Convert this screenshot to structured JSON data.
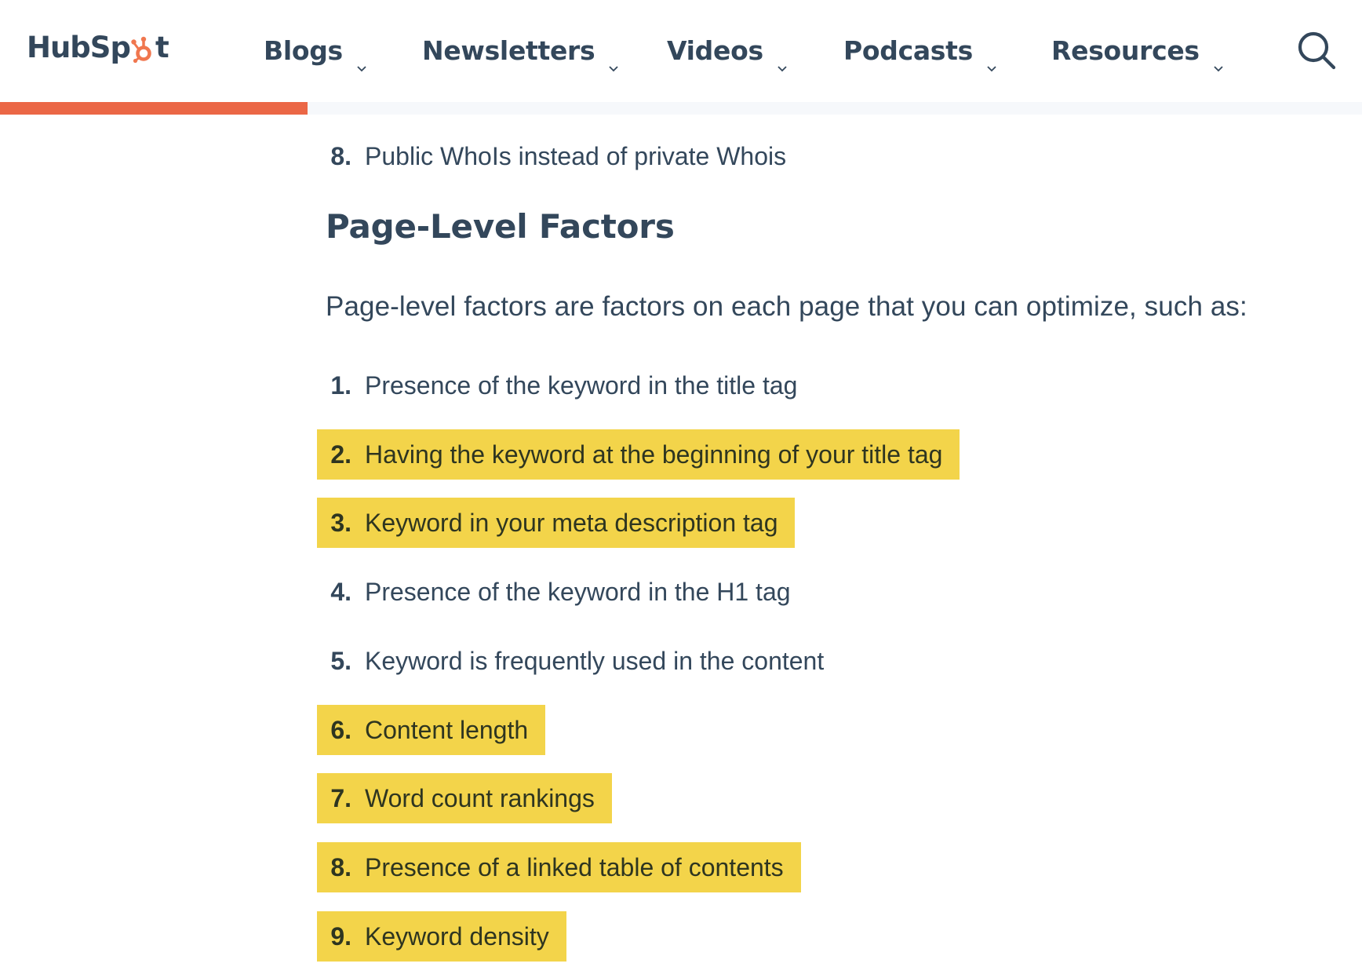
{
  "header": {
    "logo_text_1": "HubSp",
    "logo_text_2": "t",
    "logo_alt": "HubSpot",
    "nav": [
      {
        "label": "Blogs",
        "icon": "chevron-down-icon"
      },
      {
        "label": "Newsletters",
        "icon": "chevron-down-icon"
      },
      {
        "label": "Videos",
        "icon": "chevron-down-icon"
      },
      {
        "label": "Podcasts",
        "icon": "chevron-down-icon"
      },
      {
        "label": "Resources",
        "icon": "chevron-down-icon"
      }
    ],
    "search_icon": "search-icon"
  },
  "reading_progress": {
    "percent": 22.6,
    "fill_color": "#EB6746",
    "track_color": "#F6F8FB"
  },
  "content": {
    "prev_list_item": {
      "number": "8.",
      "text": "Public WhoIs instead of private Whois"
    },
    "heading": "Page-Level Factors",
    "intro": "Page-level factors are factors on each page that you can optimize, such as:",
    "highlight_color": "#F3D44A",
    "items": [
      {
        "number": "1.",
        "text": "Presence of the keyword in the title tag",
        "highlighted": false
      },
      {
        "number": "2.",
        "text": "Having the keyword at the beginning of your title tag",
        "highlighted": true
      },
      {
        "number": "3.",
        "text": "Keyword in your meta description tag",
        "highlighted": true
      },
      {
        "number": "4.",
        "text": "Presence of the keyword in the H1 tag",
        "highlighted": false
      },
      {
        "number": "5.",
        "text": "Keyword is frequently used in the content",
        "highlighted": false
      },
      {
        "number": "6.",
        "text": "Content length",
        "highlighted": true
      },
      {
        "number": "7.",
        "text": "Word count rankings",
        "highlighted": true
      },
      {
        "number": "8.",
        "text": "Presence of a linked table of contents",
        "highlighted": true
      },
      {
        "number": "9.",
        "text": "Keyword density",
        "highlighted": true
      }
    ]
  }
}
